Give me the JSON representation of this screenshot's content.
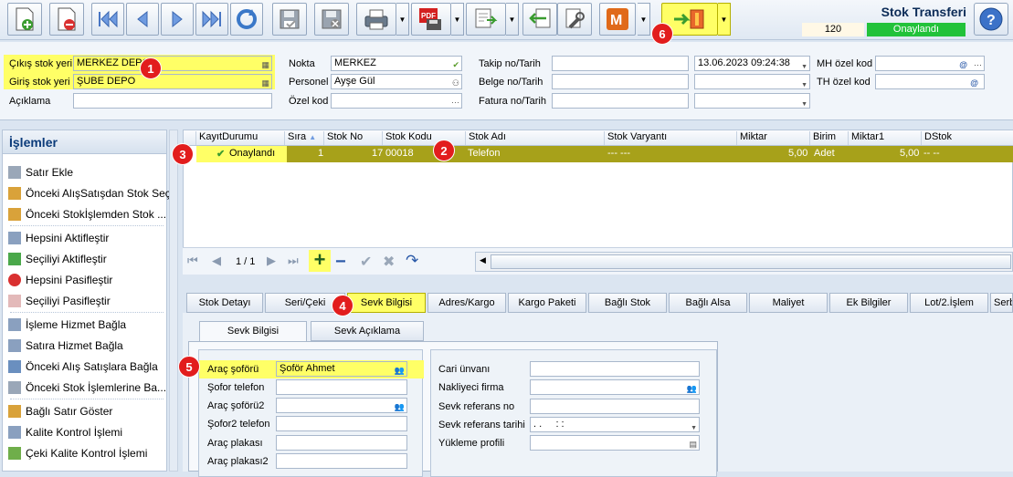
{
  "header": {
    "title": "Stok Transferi",
    "code": "120",
    "status": "Onaylandı"
  },
  "form": {
    "cikis_label": "Çıkış stok yeri",
    "cikis_value": "MERKEZ DEPO",
    "giris_label": "Giriş stok yeri",
    "giris_value": "ŞUBE DEPO",
    "aciklama_label": "Açıklama",
    "aciklama_value": "",
    "nokta_label": "Nokta",
    "nokta_value": "MERKEZ",
    "personel_label": "Personel",
    "personel_value": "Ayşe Gül",
    "ozelkod_label": "Özel kod",
    "ozelkod_value": "",
    "takip_label": "Takip no/Tarih",
    "takip_value": "",
    "takip_date": "13.06.2023 09:24:38",
    "belge_label": "Belge no/Tarih",
    "belge_value": "",
    "fatura_label": "Fatura no/Tarih",
    "fatura_value": "",
    "mh_label": "MH özel kod",
    "th_label": "TH özel kod"
  },
  "sidebar": {
    "title": "İşlemler",
    "items": [
      {
        "label": "Satır Ekle"
      },
      {
        "label": "Önceki AlışSatışdan Stok Seç"
      },
      {
        "label": "Önceki Stokİşlemden Stok ..."
      },
      {
        "label": "Hepsini Aktifleştir"
      },
      {
        "label": "Seçiliyi Aktifleştir"
      },
      {
        "label": "Hepsini Pasifleştir"
      },
      {
        "label": "Seçiliyi Pasifleştir"
      },
      {
        "label": "İşleme Hizmet Bağla"
      },
      {
        "label": "Satıra Hizmet Bağla"
      },
      {
        "label": "Önceki Alış Satışlara Bağla"
      },
      {
        "label": "Önceki Stok İşlemlerine Ba..."
      },
      {
        "label": "Bağlı Satır Göster"
      },
      {
        "label": "Kalite Kontrol İşlemi"
      },
      {
        "label": "Çeki Kalite Kontrol İşlemi"
      }
    ]
  },
  "grid": {
    "columns": [
      "KayıtDurumu",
      "Sıra",
      "Stok No",
      "Stok Kodu",
      "Stok Adı",
      "Stok Varyantı",
      "Miktar",
      "Birim",
      "Miktar1",
      "DStok"
    ],
    "row": {
      "kayit": "Onaylandı",
      "sira": "1",
      "stok_no": "17",
      "stok_kodu": "00018",
      "stok_adi": "Telefon",
      "varyant": "--- ---",
      "miktar": "5,00",
      "birim": "Adet",
      "miktar1": "5,00",
      "dstok": "-- --"
    },
    "page": "1 / 1"
  },
  "tabs": [
    "Stok Detayı",
    "Seri/Çeki",
    "Sevk Bilgisi",
    "Adres/Kargo",
    "Kargo Paketi",
    "Bağlı Stok",
    "Bağlı Alsa",
    "Maliyet",
    "Ek Bilgiler",
    "Lot/2.İşlem",
    "Serb"
  ],
  "subtabs": [
    "Sevk Bilgisi",
    "Sevk Açıklama"
  ],
  "sevk": {
    "sofor_label": "Araç şoförü",
    "sofor_value": "Şoför Ahmet",
    "sofor_tel_label": "Şofor telefon",
    "sofor2_label": "Araç şoförü2",
    "sofor2_tel_label": "Şofor2 telefon",
    "plaka_label": "Araç plakası",
    "plaka2_label": "Araç plakası2",
    "cari_label": "Cari ünvanı",
    "nakliyeci_label": "Nakliyeci firma",
    "sevk_ref_label": "Sevk referans no",
    "sevk_ref_tarih_label": "Sevk referans tarihi",
    "sevk_ref_tarih_value": ". .     : :",
    "yukleme_label": "Yükleme profili"
  },
  "badges": [
    "1",
    "2",
    "3",
    "4",
    "5",
    "6"
  ],
  "colors": {
    "highlight": "#ffff66",
    "status_green": "#22c23a",
    "row_olive": "#a7a11a",
    "badge_red": "#e21d1d"
  }
}
